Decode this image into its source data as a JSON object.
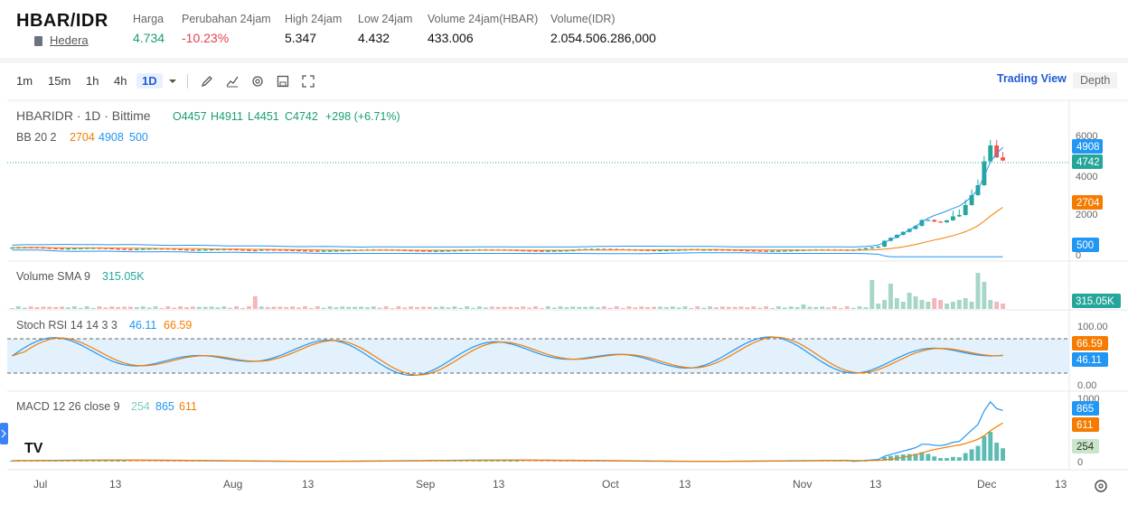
{
  "header": {
    "pair": "HBAR/IDR",
    "subtitle": "Hedera",
    "stats": [
      {
        "label": "Harga",
        "value": "4.734",
        "color": "green"
      },
      {
        "label": "Perubahan 24jam",
        "value": "-10.23%",
        "color": "red"
      },
      {
        "label": "High 24jam",
        "value": "5.347"
      },
      {
        "label": "Low 24jam",
        "value": "4.432"
      },
      {
        "label": "Volume 24jam(HBAR)",
        "value": "433.006"
      },
      {
        "label": "Volume(IDR)",
        "value": "2.054.506.286,000"
      }
    ]
  },
  "toolbar": {
    "intervals": [
      "1m",
      "15m",
      "1h",
      "4h",
      "1D"
    ],
    "active_interval": "1D",
    "trading_view": "Trading View",
    "depth": "Depth"
  },
  "chart": {
    "legend": {
      "symbol": "HBARIDR · 1D · Bittime",
      "o": "O4457",
      "h": "H4911",
      "l": "L4451",
      "c": "C4742",
      "change": "+298 (+6.71%)",
      "bb_label": "BB 20 2",
      "bb_mid": "2704",
      "bb_up": "4908",
      "bb_low": "500"
    },
    "price_axis": [
      "6000",
      "4000",
      "2000",
      "0"
    ],
    "price_tags": {
      "upper": "4908",
      "last": "4742",
      "mid": "2704",
      "lower": "500"
    },
    "volume": {
      "label": "Volume SMA 9",
      "value": "315.05K",
      "tag": "315.05K"
    },
    "stoch": {
      "label": "Stoch RSI 14 14 3 3",
      "k": "46.11",
      "d": "66.59",
      "axis_top": "100.00",
      "axis_bottom": "0.00",
      "tag_d": "66.59",
      "tag_k": "46.11"
    },
    "macd": {
      "label": "MACD 12 26 close 9",
      "hist": "254",
      "macd": "865",
      "signal": "611",
      "axis_top": "1000",
      "axis_bottom": "0",
      "tag_macd": "865",
      "tag_signal": "611",
      "tag_hist": "254"
    },
    "time_axis": [
      "Jul",
      "13",
      "Aug",
      "13",
      "Sep",
      "13",
      "Oct",
      "13",
      "Nov",
      "13",
      "Dec",
      "13"
    ],
    "logo": "TV"
  },
  "colors": {
    "up": "#26a69a",
    "down": "#ef5350",
    "blue": "#2196f3",
    "orange": "#f57c00",
    "accent": "#1f5bd6"
  },
  "chart_data": {
    "type": "candlestick",
    "x": [
      "Jul",
      "Aug",
      "Sep",
      "Oct",
      "Nov",
      "Dec"
    ],
    "series": [
      {
        "name": "BB 20 2",
        "values": [
          2704,
          4908,
          500
        ]
      }
    ],
    "ylim": [
      0,
      6500
    ],
    "last": {
      "open": 4457,
      "high": 4911,
      "low": 4451,
      "close": 4742
    }
  }
}
